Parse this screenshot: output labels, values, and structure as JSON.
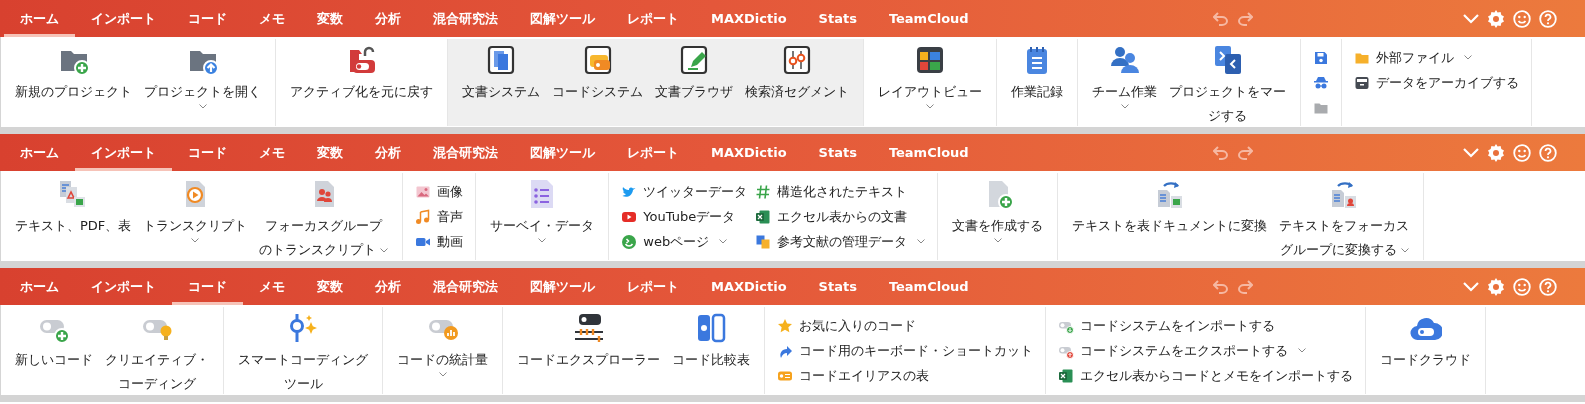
{
  "ribbons": [
    {
      "tabs": [
        {
          "label": "ホーム",
          "selected": true
        },
        {
          "label": "インポート",
          "selected": false
        },
        {
          "label": "コード",
          "selected": false
        },
        {
          "label": "メモ",
          "selected": false
        },
        {
          "label": "変数",
          "selected": false
        },
        {
          "label": "分析",
          "selected": false
        },
        {
          "label": "混合研究法",
          "selected": false
        },
        {
          "label": "図解ツール",
          "selected": false
        },
        {
          "label": "レポート",
          "selected": false
        },
        {
          "label": "MAXDictio",
          "selected": false
        },
        {
          "label": "Stats",
          "selected": false
        },
        {
          "label": "TeamCloud",
          "selected": false
        }
      ],
      "groups": [
        {
          "highlighted": false,
          "items": [
            {
              "kind": "large",
              "label": [
                "新規のプロジェクト"
              ],
              "dropdown": false
            },
            {
              "kind": "large",
              "label": [
                "プロジェクトを開く"
              ],
              "dropdown": true
            }
          ]
        },
        {
          "highlighted": false,
          "items": [
            {
              "kind": "large",
              "label": [
                "アクティブ化を元に戻す"
              ],
              "dropdown": false
            }
          ]
        },
        {
          "highlighted": true,
          "items": [
            {
              "kind": "large",
              "label": [
                "文書システム"
              ],
              "dropdown": false
            },
            {
              "kind": "large",
              "label": [
                "コードシステム"
              ],
              "dropdown": false
            },
            {
              "kind": "large",
              "label": [
                "文書ブラウザ"
              ],
              "dropdown": false
            },
            {
              "kind": "large",
              "label": [
                "検索済セグメント"
              ],
              "dropdown": false
            }
          ]
        },
        {
          "highlighted": false,
          "items": [
            {
              "kind": "large",
              "label": [
                "レイアウトビュー"
              ],
              "dropdown": true
            }
          ]
        },
        {
          "highlighted": false,
          "items": [
            {
              "kind": "large",
              "label": [
                "作業記録"
              ],
              "dropdown": false
            }
          ]
        },
        {
          "highlighted": false,
          "items": [
            {
              "kind": "large",
              "label": [
                "チーム作業"
              ],
              "dropdown": true
            },
            {
              "kind": "large",
              "label": [
                "プロジェクトをマー",
                "ジする"
              ],
              "dropdown": false
            }
          ]
        },
        {
          "highlighted": false,
          "items": [
            {
              "kind": "stack",
              "entries": [
                {
                  "dropdown": false
                },
                {
                  "dropdown": false
                },
                {
                  "dropdown": false
                }
              ]
            }
          ]
        },
        {
          "highlighted": false,
          "items": [
            {
              "kind": "stack",
              "entries": [
                {
                  "label": "外部ファイル",
                  "dropdown": true
                },
                {
                  "label": "データをアーカイブする",
                  "dropdown": false
                }
              ]
            }
          ]
        }
      ]
    },
    {
      "tabs": [
        {
          "label": "ホーム",
          "selected": false
        },
        {
          "label": "インポート",
          "selected": true
        },
        {
          "label": "コード",
          "selected": false
        },
        {
          "label": "メモ",
          "selected": false
        },
        {
          "label": "変数",
          "selected": false
        },
        {
          "label": "分析",
          "selected": false
        },
        {
          "label": "混合研究法",
          "selected": false
        },
        {
          "label": "図解ツール",
          "selected": false
        },
        {
          "label": "レポート",
          "selected": false
        },
        {
          "label": "MAXDictio",
          "selected": false
        },
        {
          "label": "Stats",
          "selected": false
        },
        {
          "label": "TeamCloud",
          "selected": false
        }
      ],
      "groups": [
        {
          "highlighted": false,
          "items": [
            {
              "kind": "large",
              "label": [
                "テキスト、PDF、表"
              ],
              "dropdown": false
            },
            {
              "kind": "large",
              "label": [
                "トランスクリプト"
              ],
              "dropdown": true
            },
            {
              "kind": "large",
              "label": [
                "フォーカスグループ",
                "のトランスクリプト"
              ],
              "dropdown": true
            }
          ]
        },
        {
          "highlighted": false,
          "items": [
            {
              "kind": "stack",
              "entries": [
                {
                  "label": "画像",
                  "dropdown": false
                },
                {
                  "label": "音声",
                  "dropdown": false
                },
                {
                  "label": "動画",
                  "dropdown": false
                }
              ]
            }
          ]
        },
        {
          "highlighted": false,
          "items": [
            {
              "kind": "large",
              "label": [
                "サーベイ・データ"
              ],
              "dropdown": true
            }
          ]
        },
        {
          "highlighted": false,
          "items": [
            {
              "kind": "stack",
              "entries": [
                {
                  "label": "ツイッターデータ",
                  "dropdown": false
                },
                {
                  "label": "YouTubeデータ",
                  "dropdown": false
                },
                {
                  "label": "webページ",
                  "dropdown": true
                }
              ]
            },
            {
              "kind": "stack",
              "entries": [
                {
                  "label": "構造化されたテキスト",
                  "dropdown": false
                },
                {
                  "label": "エクセル表からの文書",
                  "dropdown": false
                },
                {
                  "label": "参考文献の管理データ",
                  "dropdown": true
                }
              ]
            }
          ]
        },
        {
          "highlighted": false,
          "items": [
            {
              "kind": "large",
              "label": [
                "文書を作成する"
              ],
              "dropdown": true
            }
          ]
        },
        {
          "highlighted": false,
          "items": [
            {
              "kind": "large",
              "label": [
                "テキストを表ドキュメントに変換"
              ],
              "dropdown": false
            },
            {
              "kind": "large",
              "label": [
                "テキストをフォーカス",
                "グループに変換する"
              ],
              "dropdown": true
            }
          ]
        }
      ]
    },
    {
      "tabs": [
        {
          "label": "ホーム",
          "selected": false
        },
        {
          "label": "インポート",
          "selected": false
        },
        {
          "label": "コード",
          "selected": true
        },
        {
          "label": "メモ",
          "selected": false
        },
        {
          "label": "変数",
          "selected": false
        },
        {
          "label": "分析",
          "selected": false
        },
        {
          "label": "混合研究法",
          "selected": false
        },
        {
          "label": "図解ツール",
          "selected": false
        },
        {
          "label": "レポート",
          "selected": false
        },
        {
          "label": "MAXDictio",
          "selected": false
        },
        {
          "label": "Stats",
          "selected": false
        },
        {
          "label": "TeamCloud",
          "selected": false
        }
      ],
      "groups": [
        {
          "highlighted": false,
          "items": [
            {
              "kind": "large",
              "label": [
                "新しいコード"
              ],
              "dropdown": false
            },
            {
              "kind": "large",
              "label": [
                "クリエイティブ・",
                "コーディング"
              ],
              "dropdown": false
            }
          ]
        },
        {
          "highlighted": false,
          "items": [
            {
              "kind": "large",
              "label": [
                "スマートコーディング",
                "ツール"
              ],
              "dropdown": false
            }
          ]
        },
        {
          "highlighted": false,
          "items": [
            {
              "kind": "large",
              "label": [
                "コードの統計量"
              ],
              "dropdown": true
            }
          ]
        },
        {
          "highlighted": false,
          "items": [
            {
              "kind": "large",
              "label": [
                "コードエクスプローラー"
              ],
              "dropdown": false
            },
            {
              "kind": "large",
              "label": [
                "コード比較表"
              ],
              "dropdown": false
            }
          ]
        },
        {
          "highlighted": false,
          "items": [
            {
              "kind": "stack",
              "entries": [
                {
                  "label": "お気に入りのコード",
                  "dropdown": false
                },
                {
                  "label": "コード用のキーボード・ショートカット",
                  "dropdown": false
                },
                {
                  "label": "コードエイリアスの表",
                  "dropdown": false
                }
              ]
            }
          ]
        },
        {
          "highlighted": false,
          "items": [
            {
              "kind": "stack",
              "entries": [
                {
                  "label": "コードシステムをインポートする",
                  "dropdown": false
                },
                {
                  "label": "コードシステムをエクスポートする",
                  "dropdown": true
                },
                {
                  "label": "エクセル表からコードとメモをインポートする",
                  "dropdown": false
                }
              ]
            }
          ]
        },
        {
          "highlighted": false,
          "items": [
            {
              "kind": "large",
              "label": [
                "コードクラウド"
              ],
              "dropdown": false
            }
          ]
        }
      ]
    }
  ]
}
